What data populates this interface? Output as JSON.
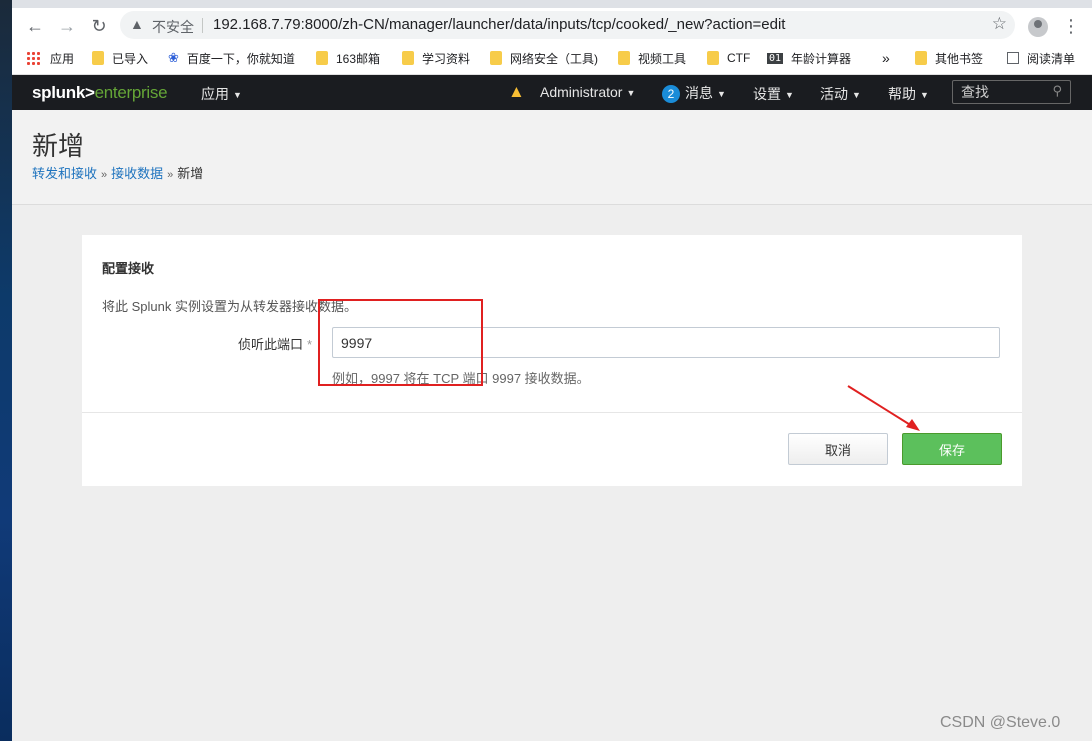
{
  "browser": {
    "security_label": "不安全",
    "url": "192.168.7.79:8000/zh-CN/manager/launcher/data/inputs/tcp/cooked/_new?action=edit"
  },
  "bookmarks": {
    "items": [
      "应用",
      "已导入",
      "百度一下，你就知道",
      "163邮箱",
      "学习资料",
      "网络安全（工具)",
      "视频工具",
      "CTF",
      "年龄计算器"
    ],
    "badge_01": "01",
    "overflow": "»",
    "other": "其他书签",
    "reading_list": "阅读清单"
  },
  "splunk_header": {
    "logo_splunk": "splunk>",
    "logo_enterprise": "enterprise",
    "apps_menu": "应用",
    "user_menu": "Administrator",
    "message_count": "2",
    "messages_menu": "消息",
    "settings_menu": "设置",
    "activity_menu": "活动",
    "help_menu": "帮助",
    "search_placeholder": "查找"
  },
  "page": {
    "title": "新增",
    "breadcrumb": [
      "转发和接收",
      "接收数据",
      "新增"
    ],
    "breadcrumb_sep": "»"
  },
  "form": {
    "section_title": "配置接收",
    "description": "将此 Splunk 实例设置为从转发器接收数据。",
    "port_label": "侦听此端口",
    "required_mark": "*",
    "port_value": "9997",
    "port_help": "例如，9997 将在 TCP 端口 9997 接收数据。",
    "cancel_label": "取消",
    "save_label": "保存"
  },
  "watermark": "CSDN @Steve.0",
  "colors": {
    "splunk_green": "#65a637",
    "save_button": "#5cc05c",
    "link": "#1e73be",
    "annotation_red": "#e02020"
  }
}
